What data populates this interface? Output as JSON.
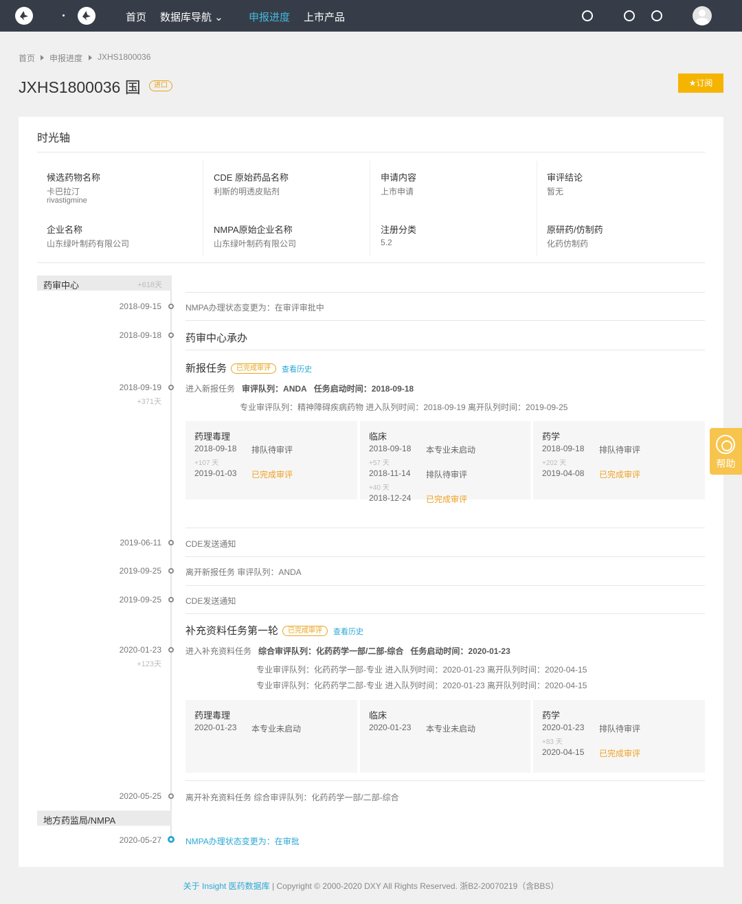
{
  "nav": {
    "links": [
      "首页",
      "数据库导航 ⌄",
      "申报进度",
      "上市产品"
    ],
    "active_link": "申报进度",
    "icons": [
      "search-icon",
      "bulb-icon",
      "question-icon",
      "user-avatar"
    ]
  },
  "breadcrumb": [
    "首页",
    "申报进度",
    "JXHS1800036"
  ],
  "header": {
    "title": "JXHS1800036 国",
    "tag": "进口",
    "subscribe": "订阅"
  },
  "timeline_title": "时光轴",
  "info": [
    {
      "label": "候选药物名称",
      "value": "卡巴拉汀",
      "value2": "rivastigmine"
    },
    {
      "label": "CDE 原始药品名称",
      "value": "利斯的明透皮贴剂"
    },
    {
      "label": "申请内容",
      "value": "上市申请"
    },
    {
      "label": "审评结论",
      "value": "暂无"
    },
    {
      "label": "企业名称",
      "value": "山东绿叶制药有限公司"
    },
    {
      "label": "NMPA原始企业名称",
      "value": "山东绿叶制药有限公司"
    },
    {
      "label": "注册分类",
      "value": "5.2"
    },
    {
      "label": "原研药/仿制药",
      "value": "化药仿制药"
    }
  ],
  "groups": [
    {
      "name": "药审中心",
      "days": "+618天"
    },
    {
      "name": "地方药监局/NMPA"
    }
  ],
  "events": {
    "e1": {
      "date": "2018-09-15",
      "text": "NMPA办理状态变更为：在审评审批中"
    },
    "e2": {
      "date": "2018-09-18",
      "text": "药审中心承办"
    },
    "task1": {
      "title": "新报任务",
      "status": "已完成审评",
      "history": "查看历史"
    },
    "e3": {
      "date": "2018-09-19",
      "days": "+371天",
      "l1": "进入新报任务",
      "l1b": "审评队列：ANDA",
      "l1c": "任务启动时间：2018-09-18",
      "l2": "专业审评队列：精神障碍疾病药物   进入队列时间：2018-09-19   离开队列时间：2019-09-25"
    },
    "e4": {
      "date": "2019-06-11",
      "text": "CDE发送通知"
    },
    "e5": {
      "date": "2019-09-25",
      "text": "离开新报任务   审评队列：ANDA"
    },
    "e6": {
      "date": "2019-09-25",
      "text": "CDE发送通知"
    },
    "task2": {
      "title": "补充资料任务第一轮",
      "status": "已完成审评",
      "history": "查看历史"
    },
    "e7": {
      "date": "2020-01-23",
      "days": "+123天",
      "l1": "进入补充资料任务",
      "l1b": "综合审评队列：化药药学一部/二部-综合",
      "l1c": "任务启动时间：2020-01-23",
      "l2": "专业审评队列：化药药学一部-专业   进入队列时间：2020-01-23   离开队列时间：2020-04-15",
      "l3": "专业审评队列：化药药学二部-专业   进入队列时间：2020-01-23   离开队列时间：2020-04-15"
    },
    "e8": {
      "date": "2020-05-25",
      "text": "离开补充资料任务   综合审评队列：化药药学一部/二部-综合"
    },
    "e9": {
      "date": "2020-05-27",
      "text": "NMPA办理状态变更为：在审批"
    }
  },
  "boxes1": [
    {
      "title": "药理毒理",
      "rows": [
        {
          "date": "2018-09-18",
          "status": "排队待审评"
        },
        {
          "gap": "+107 天"
        },
        {
          "date": "2019-01-03",
          "status": "已完成审评"
        }
      ]
    },
    {
      "title": "临床",
      "rows": [
        {
          "date": "2018-09-18",
          "status": "本专业未启动"
        },
        {
          "gap": "+57 天"
        },
        {
          "date": "2018-11-14",
          "status": "排队待审评"
        },
        {
          "gap": "+40 天"
        },
        {
          "date": "2018-12-24",
          "status": "已完成审评"
        }
      ]
    },
    {
      "title": "药学",
      "rows": [
        {
          "date": "2018-09-18",
          "status": "排队待审评"
        },
        {
          "gap": "+202 天"
        },
        {
          "date": "2019-04-08",
          "status": "已完成审评"
        }
      ]
    }
  ],
  "boxes2": [
    {
      "title": "药理毒理",
      "rows": [
        {
          "date": "2020-01-23",
          "status": "本专业未启动"
        }
      ]
    },
    {
      "title": "临床",
      "rows": [
        {
          "date": "2020-01-23",
          "status": "本专业未启动"
        }
      ]
    },
    {
      "title": "药学",
      "rows": [
        {
          "date": "2020-01-23",
          "status": "排队待审评"
        },
        {
          "gap": "+83 天"
        },
        {
          "date": "2020-04-15",
          "status": "已完成审评"
        }
      ]
    }
  ],
  "help": "帮助",
  "footer": {
    "link": "关于 Insight 医药数据库",
    "sep": " | ",
    "text": "Copyright © 2000-2020 DXY All Rights Reserved. 浙B2-20070219（含BBS）"
  },
  "colors": {
    "nav_bg": "#373d48",
    "accent": "#2aa7d4",
    "warning": "#f0a020",
    "subscribe": "#f5b400"
  }
}
